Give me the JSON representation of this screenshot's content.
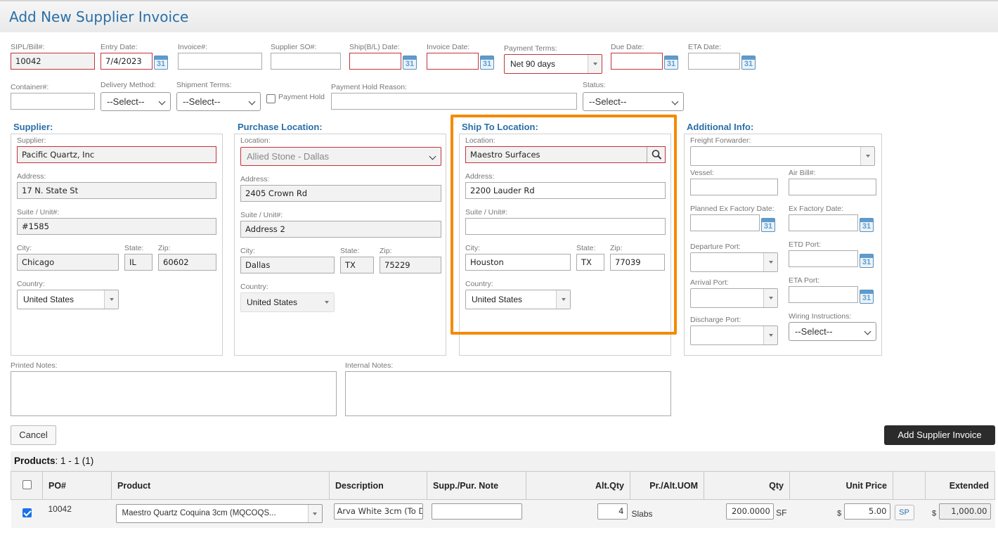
{
  "page": {
    "title": "Add New Supplier Invoice"
  },
  "top": {
    "sipl": {
      "label": "SIPL/Bill#:",
      "value": "10042"
    },
    "entry_date": {
      "label": "Entry Date:",
      "value": "7/4/2023"
    },
    "invoice_no": {
      "label": "Invoice#:",
      "value": ""
    },
    "supplier_so": {
      "label": "Supplier SO#:",
      "value": ""
    },
    "ship_date": {
      "label": "Ship(B/L) Date:",
      "value": ""
    },
    "invoice_date": {
      "label": "Invoice Date:",
      "value": ""
    },
    "payment_terms": {
      "label": "Payment Terms:",
      "value": "Net 90 days"
    },
    "due_date": {
      "label": "Due Date:",
      "value": ""
    },
    "eta_date": {
      "label": "ETA Date:",
      "value": ""
    },
    "container": {
      "label": "Container#:",
      "value": ""
    },
    "delivery_method": {
      "label": "Delivery Method:",
      "value": "--Select--"
    },
    "shipment_terms": {
      "label": "Shipment Terms:",
      "value": "--Select--"
    },
    "payment_hold": {
      "label": "Payment Hold"
    },
    "payment_hold_reason": {
      "label": "Payment Hold Reason:",
      "value": ""
    },
    "status": {
      "label": "Status:",
      "value": "--Select--"
    },
    "calendar_day": "31"
  },
  "supplier": {
    "title": "Supplier:",
    "supplier_label": "Supplier:",
    "supplier_value": "Pacific Quartz, Inc",
    "address_label": "Address:",
    "address_value": "17 N. State St",
    "suite_label": "Suite / Unit#:",
    "suite_value": "#1585",
    "city_label": "City:",
    "city_value": "Chicago",
    "state_label": "State:",
    "state_value": "IL",
    "zip_label": "Zip:",
    "zip_value": "60602",
    "country_label": "Country:",
    "country_value": "United States"
  },
  "purchase": {
    "title": "Purchase Location:",
    "location_label": "Location:",
    "location_value": "Allied Stone - Dallas",
    "address_label": "Address:",
    "address_value": "2405 Crown Rd",
    "suite_label": "Suite / Unit#:",
    "suite_value": "Address 2",
    "city_label": "City:",
    "city_value": "Dallas",
    "state_label": "State:",
    "state_value": "TX",
    "zip_label": "Zip:",
    "zip_value": "75229",
    "country_label": "Country:",
    "country_value": "United States"
  },
  "ship_to": {
    "title": "Ship To Location:",
    "location_label": "Location:",
    "location_value": "Maestro Surfaces",
    "address_label": "Address:",
    "address_value": "2200 Lauder Rd",
    "suite_label": "Suite / Unit#:",
    "suite_value": "",
    "city_label": "City:",
    "city_value": "Houston",
    "state_label": "State:",
    "state_value": "TX",
    "zip_label": "Zip:",
    "zip_value": "77039",
    "country_label": "Country:",
    "country_value": "United States"
  },
  "additional": {
    "title": "Additional Info:",
    "freight_forwarder": "Freight Forwarder:",
    "vessel": "Vessel:",
    "air_bill": "Air Bill#:",
    "planned_ex_factory": "Planned Ex Factory Date:",
    "ex_factory": "Ex Factory Date:",
    "departure_port": "Departure Port:",
    "etd_port": "ETD Port:",
    "arrival_port": "Arrival Port:",
    "eta_port": "ETA Port:",
    "wiring_instructions": "Wiring Instructions:",
    "wiring_value": "--Select--",
    "discharge_port": "Discharge Port:"
  },
  "notes": {
    "printed_label": "Printed Notes:",
    "internal_label": "Internal Notes:"
  },
  "actions": {
    "cancel": "Cancel",
    "add": "Add Supplier Invoice"
  },
  "products": {
    "label": "Products",
    "range": ": 1 - 1 (1)",
    "columns": {
      "po": "PO#",
      "product": "Product",
      "description": "Description",
      "supp_note": "Supp./Pur. Note",
      "alt_qty": "Alt.Qty",
      "pr_alt_uom": "Pr./Alt.UOM",
      "qty": "Qty",
      "unit_price": "Unit Price",
      "extended": "Extended"
    },
    "rows": [
      {
        "po": "10042",
        "product": "Maestro Quartz Coquina 3cm (MQCOQS...",
        "description": "Arva White 3cm  (To D",
        "supp_note": "",
        "alt_qty": "4",
        "alt_uom": "Slabs",
        "qty": "200.0000",
        "uom": "SF",
        "currency": "$",
        "unit_price": "5.00",
        "sp": "SP",
        "extended": "1,000.00"
      }
    ]
  },
  "colors": {
    "accent": "#2a6fa8",
    "required": "#c2333c",
    "highlight": "#f58a07",
    "primary_button": "#2b2b2b"
  }
}
